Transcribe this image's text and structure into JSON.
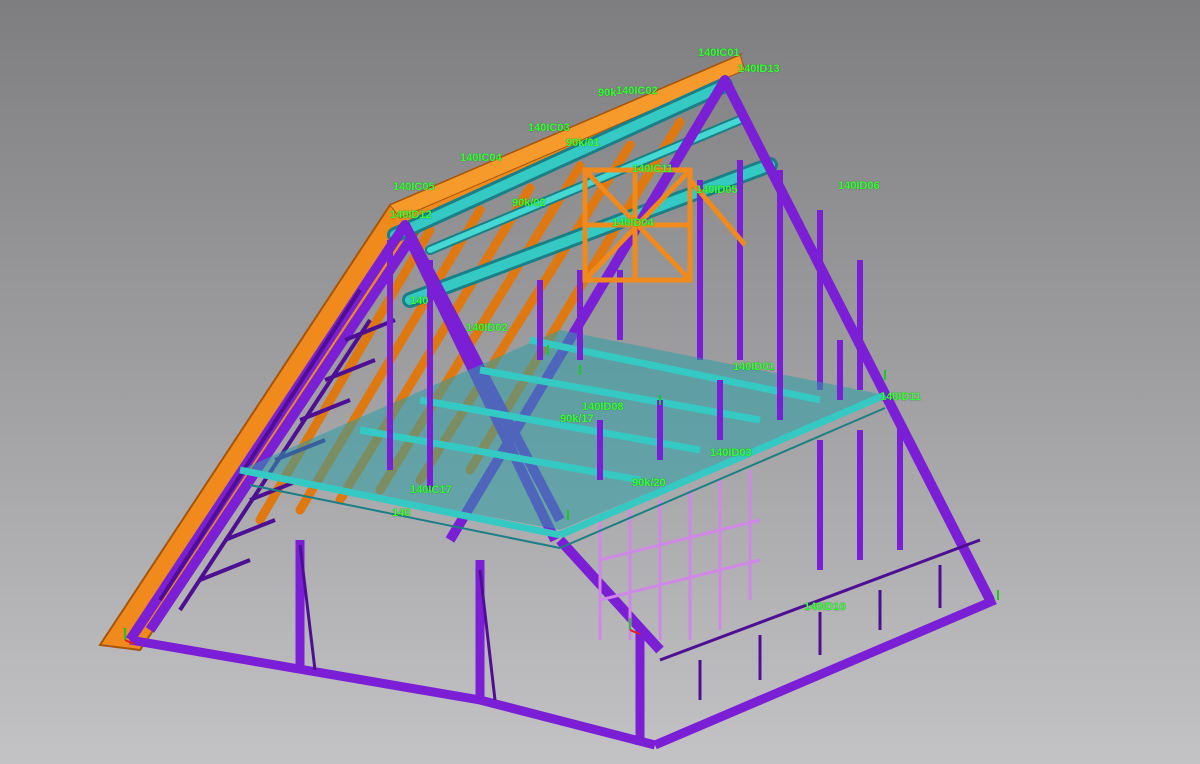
{
  "labels": [
    {
      "id": "ridge-a",
      "text": "140IC01"
    },
    {
      "id": "ridge-b",
      "text": "140ID13"
    },
    {
      "id": "top-purlin",
      "text": "140IC02"
    },
    {
      "id": "top-purlin-prefix",
      "text": "90k"
    },
    {
      "id": "purlin-c03",
      "text": "140IC03"
    },
    {
      "id": "purlin-c04",
      "text": "140IC04"
    },
    {
      "id": "purlin-c05",
      "text": "140IC05"
    },
    {
      "id": "small-1",
      "text": "90k/01"
    },
    {
      "id": "small-2",
      "text": "140IC11"
    },
    {
      "id": "small-3",
      "text": "140ID05"
    },
    {
      "id": "right-wall",
      "text": "140ID06"
    },
    {
      "id": "left-rafter",
      "text": "140ID12"
    },
    {
      "id": "mid-1",
      "text": "90k/02"
    },
    {
      "id": "mid-2",
      "text": "140ID04"
    },
    {
      "id": "mid-3",
      "text": "140"
    },
    {
      "id": "mid-4",
      "text": "140ID02"
    },
    {
      "id": "deck-1",
      "text": "140ID01"
    },
    {
      "id": "deck-2",
      "text": "90k/17"
    },
    {
      "id": "deck-3",
      "text": "140ID11"
    },
    {
      "id": "deck-4",
      "text": "90k/20"
    },
    {
      "id": "deck-5",
      "text": "140ID03"
    },
    {
      "id": "deck-6",
      "text": "140ID08"
    },
    {
      "id": "deck-7",
      "text": "140IC17"
    },
    {
      "id": "ground-right",
      "text": "140ID10"
    },
    {
      "id": "left-low",
      "text": "140"
    }
  ],
  "colors": {
    "frame": "#7a1fd6",
    "frame_dark": "#4e0f94",
    "joist": "#35c9c4",
    "joist_dark": "#1a7f86",
    "roof": "#f18a1c",
    "roof_dark": "#a85406",
    "label": "#3cff3c"
  },
  "icons": [
    "axis-marker-icon"
  ]
}
